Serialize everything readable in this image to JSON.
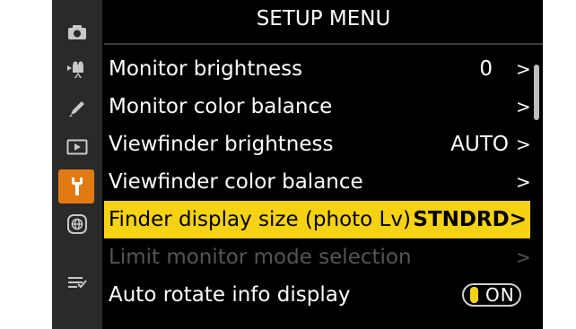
{
  "header": {
    "title": "SETUP MENU"
  },
  "sidebar": {
    "items": [
      {
        "name": "photo-shooting-menu-icon",
        "active": false
      },
      {
        "name": "movie-shooting-menu-icon",
        "active": false
      },
      {
        "name": "custom-settings-menu-icon",
        "active": false
      },
      {
        "name": "playback-menu-icon",
        "active": false
      },
      {
        "name": "setup-menu-icon",
        "active": true
      },
      {
        "name": "network-menu-icon",
        "active": false
      },
      {
        "name": "my-menu-icon",
        "active": false
      }
    ]
  },
  "menu": {
    "items": [
      {
        "label": "Monitor brightness",
        "value": "0",
        "chevron": ">"
      },
      {
        "label": "Monitor color balance",
        "value": "",
        "chevron": ">"
      },
      {
        "label": "Viewfinder brightness",
        "value": "AUTO",
        "chevron": ">"
      },
      {
        "label": "Viewfinder color balance",
        "value": "",
        "chevron": ">"
      },
      {
        "label": "Finder display size (photo Lv)",
        "value": "STNDRD>",
        "chevron": ""
      },
      {
        "label": "Limit monitor mode selection",
        "value": "",
        "chevron": ">"
      },
      {
        "label": "Auto rotate info display",
        "value": "ON",
        "chevron": ""
      }
    ]
  },
  "colors": {
    "highlight": "#f5d214",
    "active_tab": "#e27a13",
    "disabled_text": "#555555"
  }
}
